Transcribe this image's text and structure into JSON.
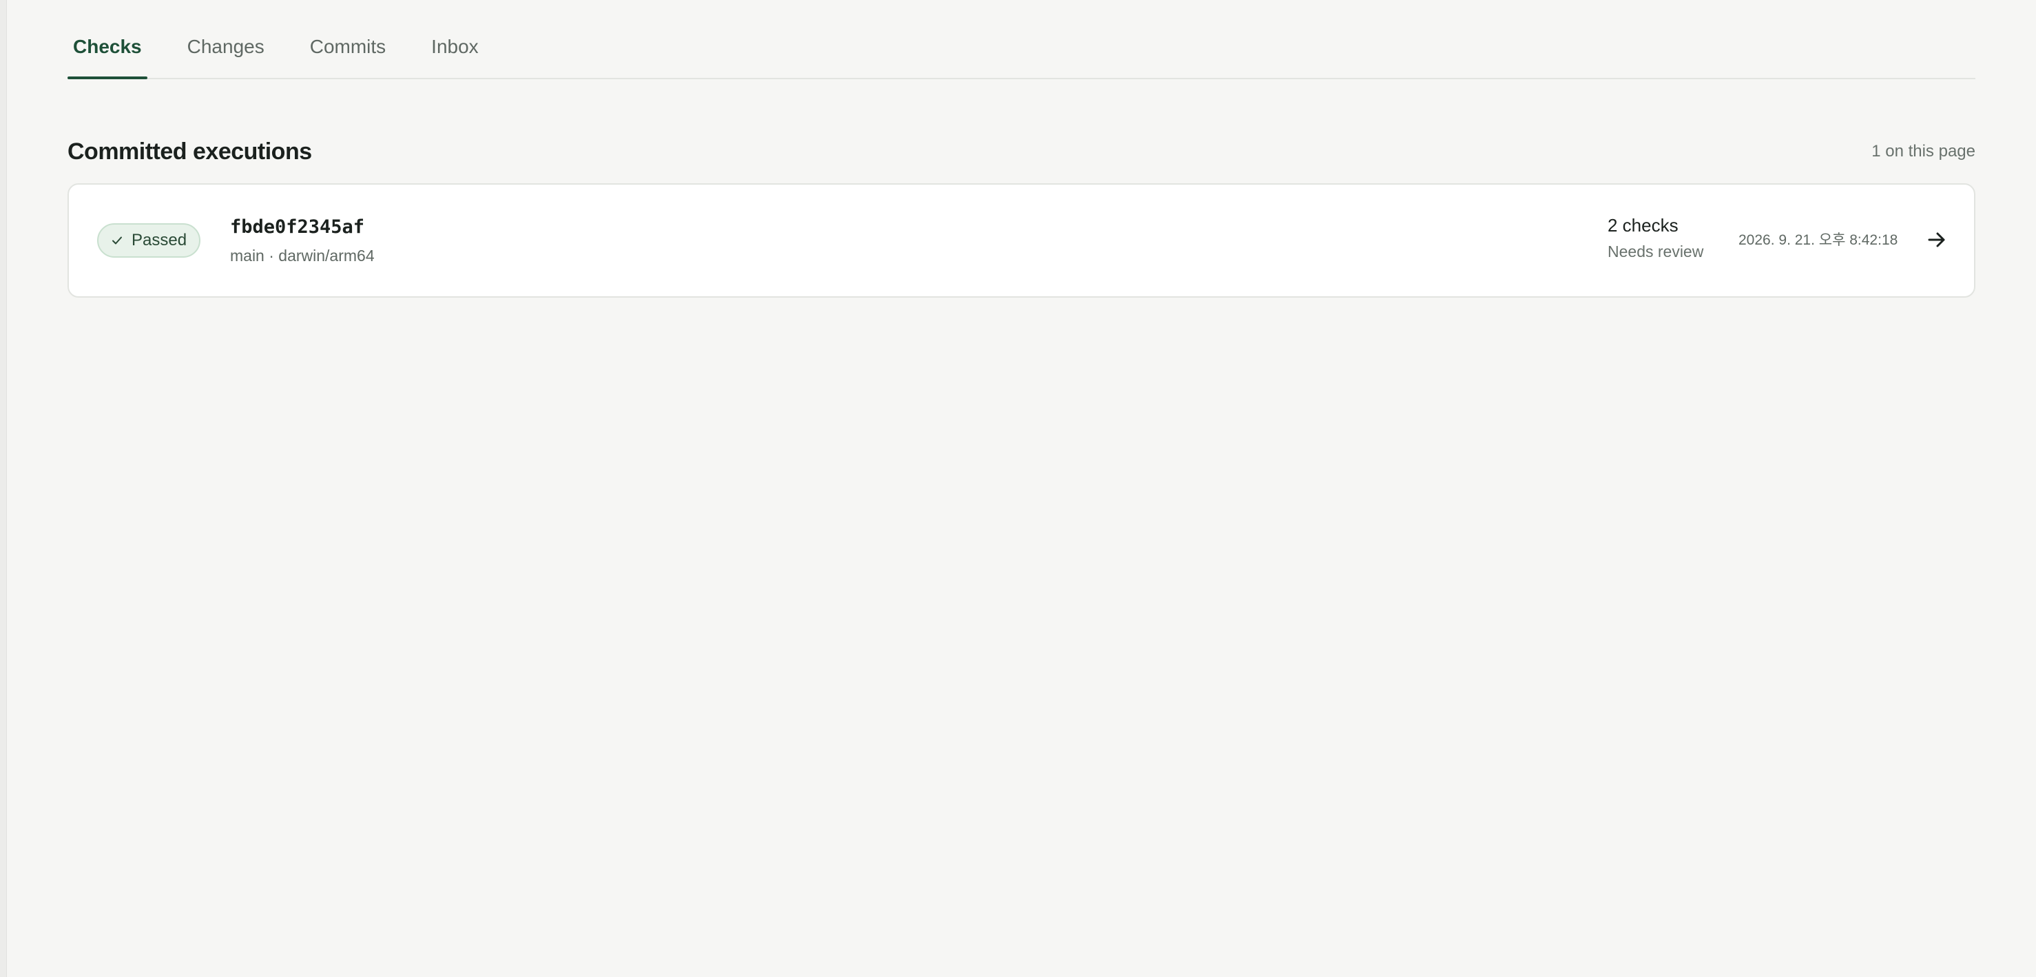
{
  "tabs": [
    {
      "label": "Checks",
      "active": true
    },
    {
      "label": "Changes",
      "active": false
    },
    {
      "label": "Commits",
      "active": false
    },
    {
      "label": "Inbox",
      "active": false
    }
  ],
  "section": {
    "title": "Committed executions",
    "count_label": "1 on this page"
  },
  "executions": [
    {
      "status": "Passed",
      "status_icon": "check-icon",
      "commit": "fbde0f2345af",
      "meta": "main · darwin/arm64",
      "checks": "2 checks",
      "review": "Needs review",
      "timestamp": "2026. 9. 21. 오후 8:42:18",
      "action_icon": "arrow-right-icon"
    }
  ],
  "colors": {
    "accent": "#1e5038",
    "badge_bg": "#e8f2ea",
    "badge_border": "#c9e0cf",
    "page_bg": "#f6f6f4"
  }
}
